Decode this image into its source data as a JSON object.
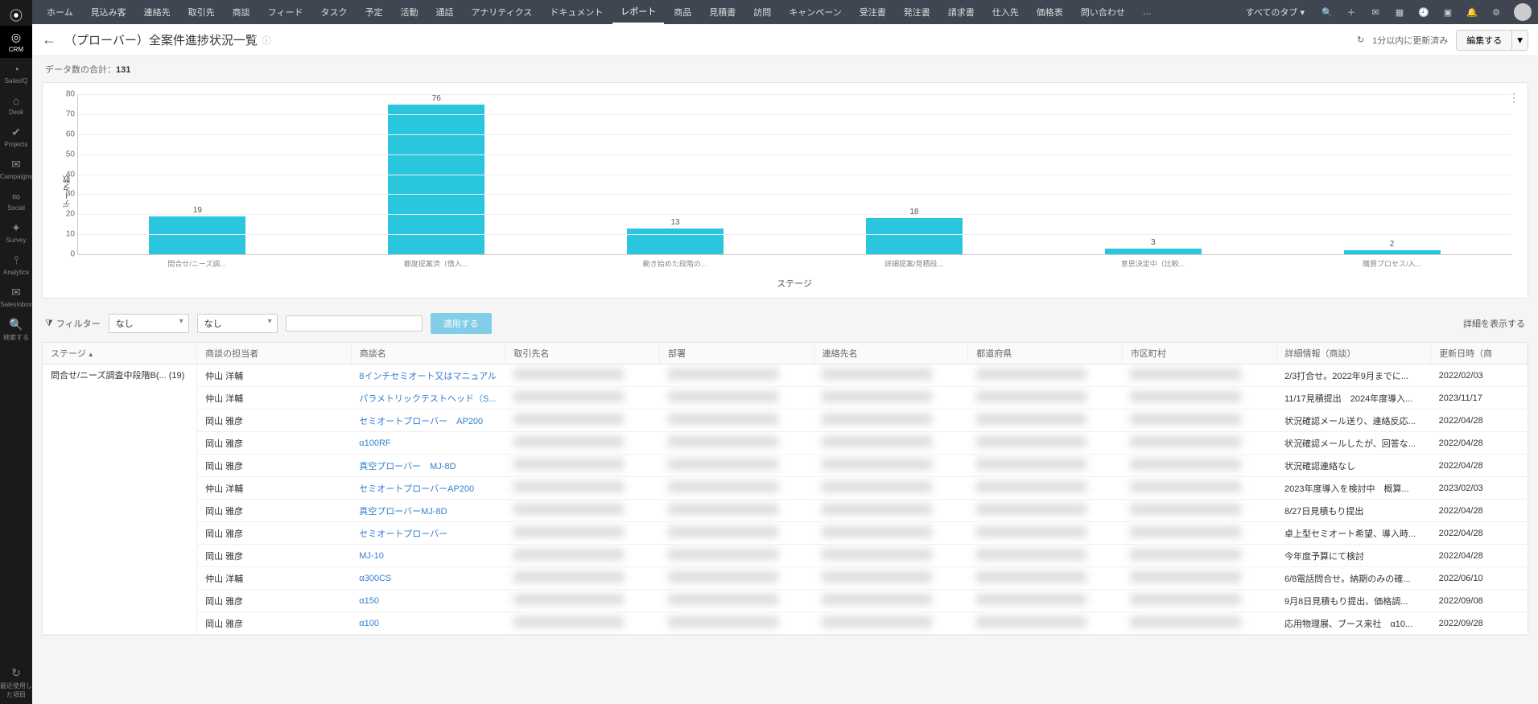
{
  "leftbar": {
    "items": [
      {
        "label": "CRM",
        "icon": "◎"
      },
      {
        "label": "SalesIQ",
        "icon": "◔"
      },
      {
        "label": "Desk",
        "icon": "⌂"
      },
      {
        "label": "Projects",
        "icon": "✔"
      },
      {
        "label": "Campaigns",
        "icon": "✉"
      },
      {
        "label": "Social",
        "icon": "∞"
      },
      {
        "label": "Survey",
        "icon": "✦"
      },
      {
        "label": "Analytics",
        "icon": "⫯"
      },
      {
        "label": "SalesInbox",
        "icon": "✉"
      },
      {
        "label": "検索する",
        "icon": "🔍"
      }
    ],
    "bottom": {
      "label": "最近使用した項目",
      "icon": "↻"
    }
  },
  "topmenu": [
    "ホーム",
    "見込み客",
    "連絡先",
    "取引先",
    "商談",
    "フィード",
    "タスク",
    "予定",
    "活動",
    "通話",
    "アナリティクス",
    "ドキュメント",
    "レポート",
    "商品",
    "見積書",
    "訪問",
    "キャンペーン",
    "受注書",
    "発注書",
    "請求書",
    "仕入先",
    "価格表",
    "問い合わせ",
    "…"
  ],
  "topmenu_active": 12,
  "topright": {
    "alltabs": "すべてのタブ ▾"
  },
  "header": {
    "title": "（プローバー）全案件進捗状況一覧",
    "refresh": "1分以内に更新済み",
    "edit": "編集する"
  },
  "count": {
    "label": "データ数の合計：",
    "value": "131"
  },
  "chart_data": {
    "type": "bar",
    "title": "",
    "xlabel": "ステージ",
    "ylabel": "データ数",
    "ylim": [
      0,
      80
    ],
    "yticks": [
      0,
      10,
      20,
      30,
      40,
      50,
      60,
      70,
      80
    ],
    "categories": [
      "問合せ/ニーズ調...",
      "都度提案済（借入...",
      "動き始めた段階の...",
      "詳細提案/見積段...",
      "意思決定中（比較...",
      "購買プロセス/入..."
    ],
    "values": [
      19,
      76,
      13,
      18,
      3,
      2
    ]
  },
  "filter": {
    "label": "フィルター",
    "sel1": "なし",
    "sel2": "なし",
    "input": "",
    "apply": "適用する",
    "detail": "詳細を表示する"
  },
  "table": {
    "headers": [
      "ステージ",
      "商談の担当者",
      "商談名",
      "取引先名",
      "部署",
      "連絡先名",
      "都道府県",
      "市区町村",
      "詳細情報（商談）",
      "更新日時（商"
    ],
    "stage_group": "問合せ/ニーズ調査中段階B(...  (19)",
    "rows": [
      {
        "owner": "仲山 洋輔",
        "prod": "8インチセミオート又はマニュアル",
        "info": "2/3打合せ。2022年9月までに...",
        "date": "2022/02/03"
      },
      {
        "owner": "仲山 洋輔",
        "prod": "パラメトリックテストヘッド（S...",
        "info": "11/17見積提出　2024年度導入...",
        "date": "2023/11/17"
      },
      {
        "owner": "岡山 雅彦",
        "prod": "セミオートプローバー　AP200",
        "info": "状況確認メール送り、連絡反応...",
        "date": "2022/04/28"
      },
      {
        "owner": "岡山 雅彦",
        "prod": "α100RF",
        "info": "状況確認メールしたが、回答な...",
        "date": "2022/04/28"
      },
      {
        "owner": "岡山 雅彦",
        "prod": "真空プローバー　MJ-8D",
        "info": "状況確認連絡なし",
        "date": "2022/04/28"
      },
      {
        "owner": "仲山 洋輔",
        "prod": "セミオートプローバーAP200",
        "info": "2023年度導入を検討中　概算...",
        "date": "2023/02/03"
      },
      {
        "owner": "岡山 雅彦",
        "prod": "真空プローバーMJ-8D",
        "info": "8/27日見積もり提出",
        "date": "2022/04/28"
      },
      {
        "owner": "岡山 雅彦",
        "prod": "セミオートプローバー",
        "info": "卓上型セミオート希望、導入時...",
        "date": "2022/04/28"
      },
      {
        "owner": "岡山 雅彦",
        "prod": "MJ-10",
        "info": "今年度予算にて検討",
        "date": "2022/04/28"
      },
      {
        "owner": "仲山 洋輔",
        "prod": "α300CS",
        "info": "6/8電話問合せ。納期のみの確...",
        "date": "2022/06/10"
      },
      {
        "owner": "岡山 雅彦",
        "prod": "α150",
        "info": "9月8日見積もり提出、価格調...",
        "date": "2022/09/08"
      },
      {
        "owner": "岡山 雅彦",
        "prod": "α100",
        "info": "応用物理展、ブース来社　α10...",
        "date": "2022/09/28"
      }
    ]
  }
}
